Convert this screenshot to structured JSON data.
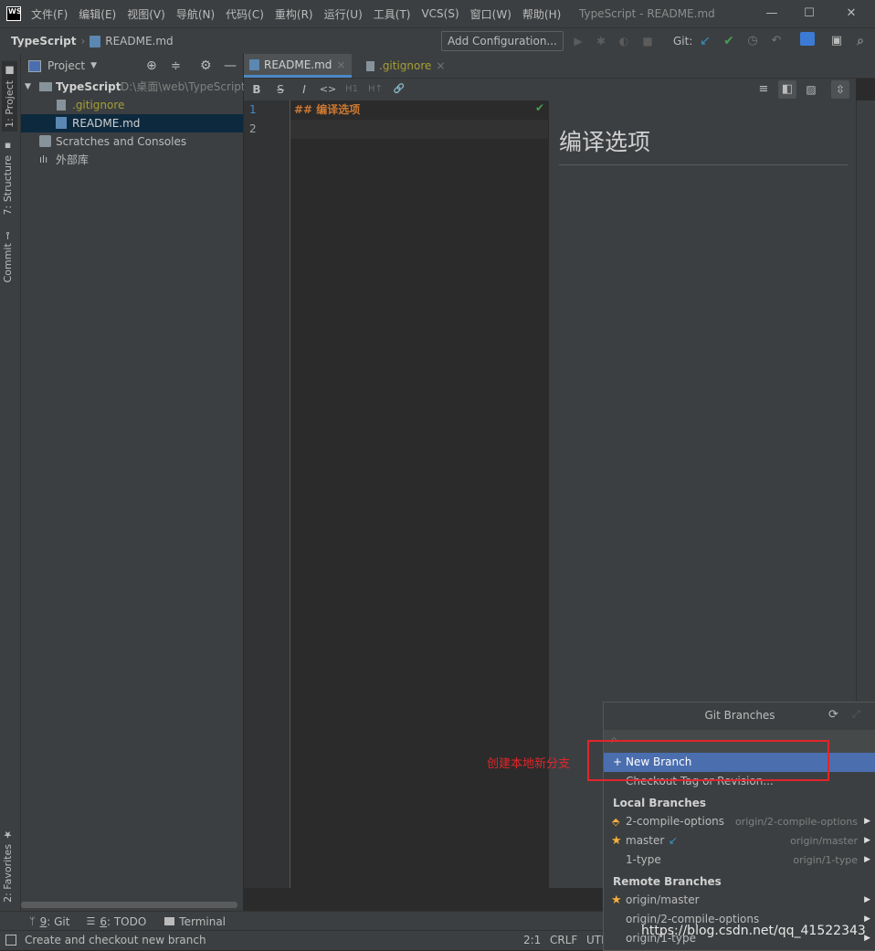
{
  "titlebar": {
    "app_logo": "WS",
    "menu": [
      "文件(F)",
      "编辑(E)",
      "视图(V)",
      "导航(N)",
      "代码(C)",
      "重构(R)",
      "运行(U)",
      "工具(T)",
      "VCS(S)",
      "窗口(W)",
      "帮助(H)"
    ],
    "window_title": "TypeScript - README.md",
    "minimize": "—",
    "maximize": "☐",
    "close": "✕"
  },
  "navbar": {
    "project": "TypeScript",
    "file": "README.md",
    "add_configuration": "Add Configuration...",
    "git_label": "Git:"
  },
  "left_tool_windows": [
    "1: Project",
    "7: Structure",
    "Commit",
    "2: Favorites"
  ],
  "project_panel": {
    "title": "Project",
    "tree": [
      {
        "label": "TypeScript",
        "path": "D:\\桌面\\web\\TypeScript"
      },
      {
        "label": ".gitignore"
      },
      {
        "label": "README.md"
      },
      {
        "label": "Scratches and Consoles"
      },
      {
        "label": "外部库"
      }
    ]
  },
  "editor_tabs": [
    {
      "label": "README.md",
      "close": "×"
    },
    {
      "label": ".gitignore",
      "close": "×"
    }
  ],
  "md_toolbar": [
    "B",
    "S",
    "I",
    "<>",
    "H1",
    "H↑",
    "🔗"
  ],
  "editor": {
    "lines": [
      {
        "num": "1",
        "text": "## 编译选项"
      },
      {
        "num": "2",
        "text": ""
      }
    ]
  },
  "preview": {
    "heading": "编译选项"
  },
  "bottom_tabs": [
    {
      "num": "9",
      "label": ": Git"
    },
    {
      "num": "6",
      "label": ": TODO"
    },
    {
      "num": "",
      "label": "Terminal"
    }
  ],
  "statusbar": {
    "message": "Create and checkout new branch",
    "position": "2:1",
    "line_sep": "CRLF",
    "encoding": "UTF"
  },
  "git_popup": {
    "title": "Git Branches",
    "actions": [
      "New Branch",
      "Checkout Tag or Revision..."
    ],
    "local_header": "Local Branches",
    "local": [
      {
        "name": "2-compile-options",
        "tracking": "origin/2-compile-options"
      },
      {
        "name": "master",
        "tracking": "origin/master"
      },
      {
        "name": "1-type",
        "tracking": "origin/1-type"
      }
    ],
    "remote_header": "Remote Branches",
    "remote": [
      {
        "name": "origin/master"
      },
      {
        "name": "origin/2-compile-options"
      },
      {
        "name": "origin/1-type"
      }
    ]
  },
  "annotation": "创建本地新分支",
  "watermark": "https://blog.csdn.net/qq_41522343",
  "colors": {
    "accent": "#4b6eaf",
    "selection": "#0d293e",
    "git_check": "#499c54",
    "git_arrow": "#3592c4",
    "star": "#f4af3d",
    "annotation": "#e0262b",
    "ignored_file": "#a59f35"
  }
}
